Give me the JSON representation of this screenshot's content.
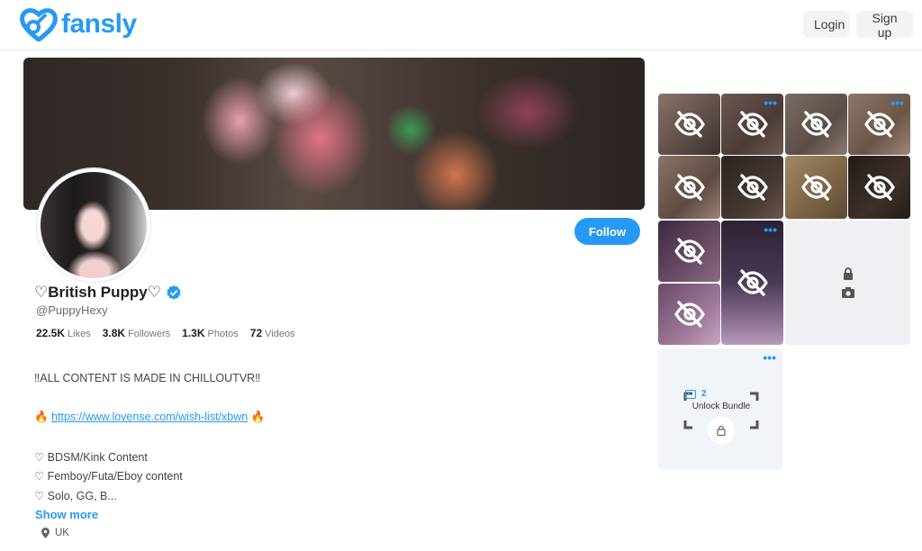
{
  "header": {
    "logo_text": "fansly",
    "login_label": "Login",
    "signup_label": "Sign up"
  },
  "profile": {
    "display_name": "♡British Puppy♡",
    "handle": "@PuppyHexy",
    "follow_label": "Follow",
    "stats": [
      {
        "value": "22.5K",
        "label": "Likes"
      },
      {
        "value": "3.8K",
        "label": "Followers"
      },
      {
        "value": "1.3K",
        "label": "Photos"
      },
      {
        "value": "72",
        "label": "Videos"
      }
    ],
    "bio": {
      "line1": "‼ALL CONTENT IS MADE IN CHILLOUTVR‼",
      "link_prefix": "🔥",
      "link_text": "https://www.lovense.com/wish-list/xbwn",
      "link_suffix": "🔥",
      "line3": "♡ BDSM/Kink Content",
      "line4": "♡ Femboy/Futa/Eboy content",
      "line5": "♡ Solo, GG, B..."
    },
    "show_more_label": "Show more",
    "location": "UK"
  },
  "media": {
    "more_icon": "•••",
    "bundle_count": "2",
    "bundle_label": "Unlock Bundle"
  },
  "colors": {
    "accent": "#2699f7"
  }
}
